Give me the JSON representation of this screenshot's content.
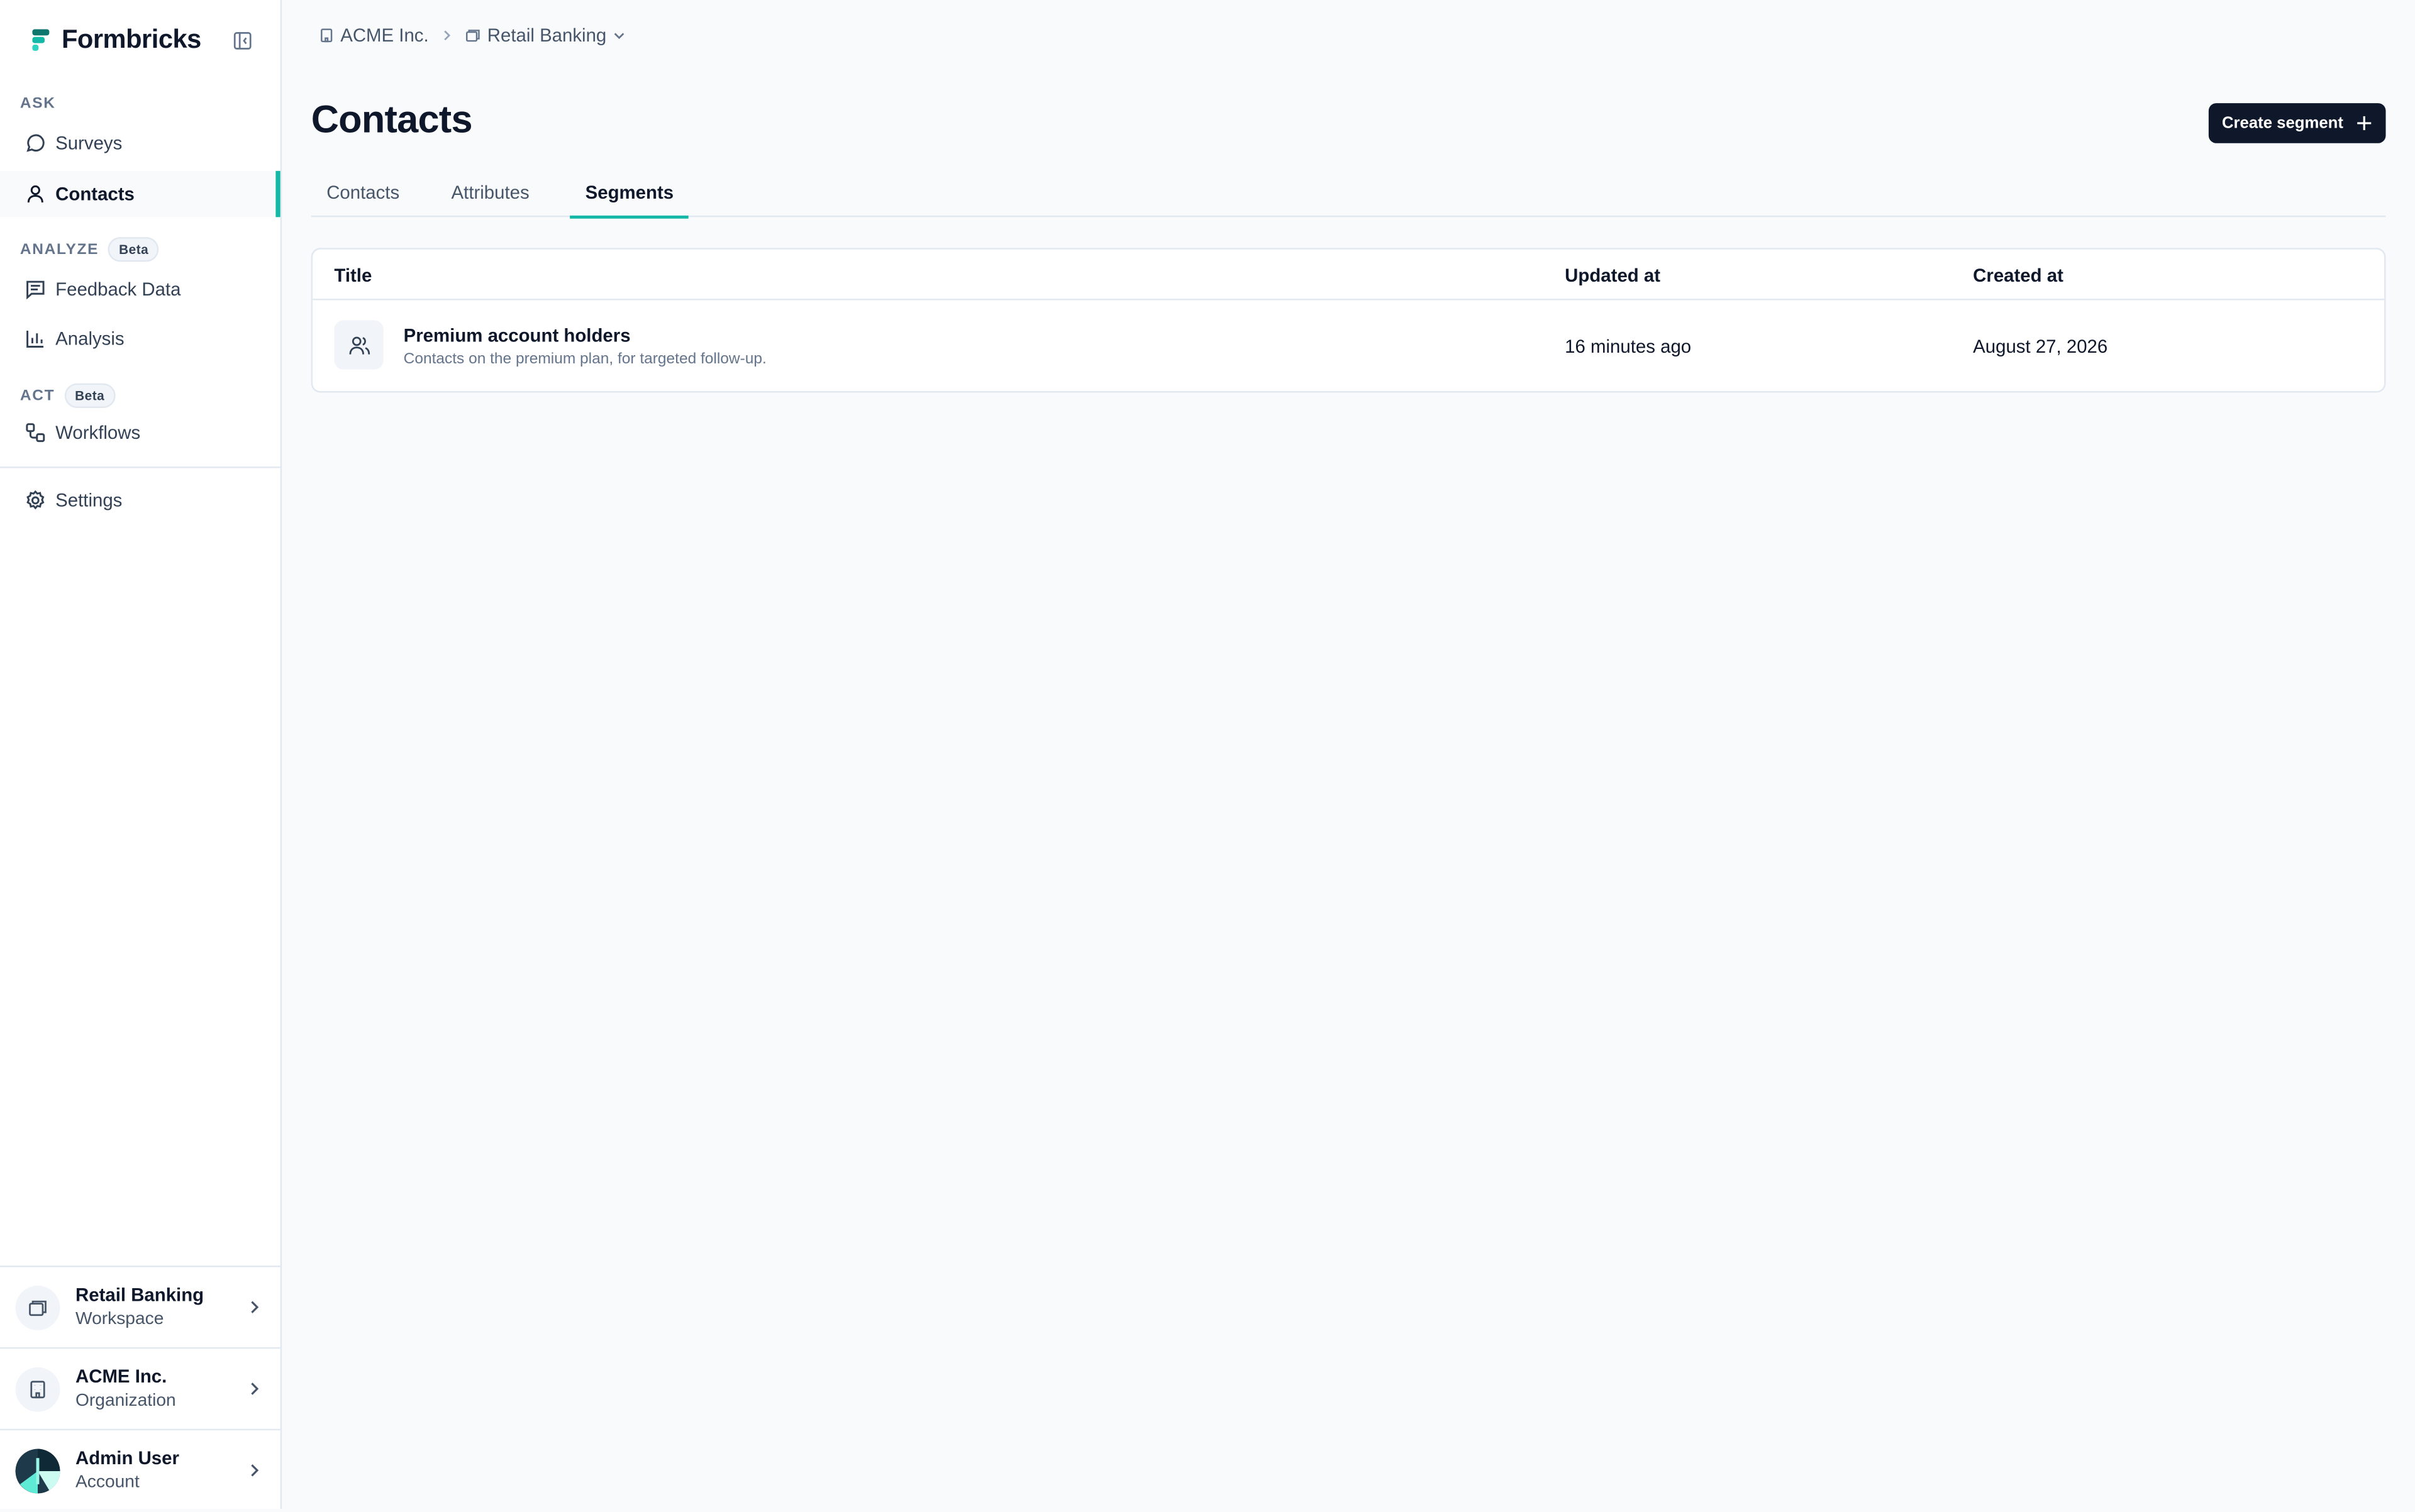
{
  "app": {
    "name": "Formbricks",
    "accent_color": "#14b8a6",
    "dark_color": "#0f172a"
  },
  "sidebar": {
    "sections": {
      "ask": "ASK",
      "analyze": "ANALYZE",
      "act": "ACT"
    },
    "beta_badge": "Beta",
    "items": {
      "surveys": "Surveys",
      "contacts": "Contacts",
      "feedback_data": "Feedback Data",
      "analysis": "Analysis",
      "workflows": "Workflows",
      "settings": "Settings"
    },
    "active_item": "contacts",
    "footer": {
      "workspace": {
        "title": "Retail Banking",
        "subtitle": "Workspace"
      },
      "organization": {
        "title": "ACME Inc.",
        "subtitle": "Organization"
      },
      "account": {
        "title": "Admin User",
        "subtitle": "Account"
      }
    }
  },
  "breadcrumb": {
    "organization": "ACME Inc.",
    "workspace": "Retail Banking"
  },
  "header": {
    "title": "Contacts",
    "create_button": "Create segment"
  },
  "tabs": [
    {
      "label": "Contacts"
    },
    {
      "label": "Attributes"
    },
    {
      "label": "Segments"
    }
  ],
  "active_tab": "Segments",
  "table": {
    "columns": {
      "title": "Title",
      "updated": "Updated at",
      "created": "Created at"
    },
    "rows": [
      {
        "title": "Premium account holders",
        "description": "Contacts on the premium plan, for targeted follow-up.",
        "updated": "16 minutes ago",
        "created": "August 27, 2026"
      }
    ]
  }
}
